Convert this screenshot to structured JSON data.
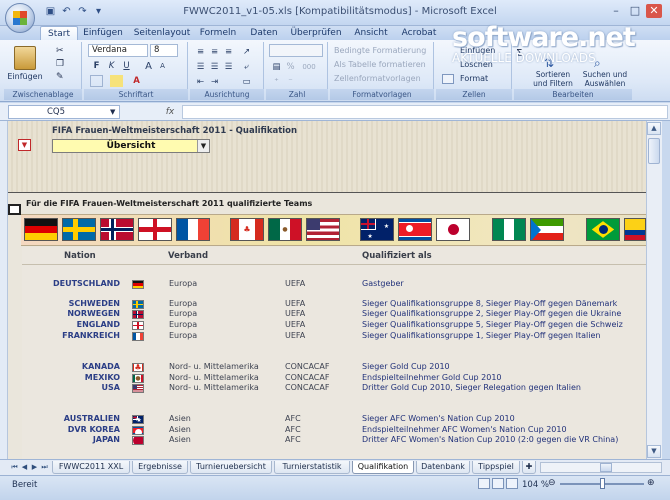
{
  "window": {
    "title": "FWWC2011_v1-05.xls  [Kompatibilitätsmodus] - Microsoft Excel",
    "minimize": "–",
    "maximize": "□",
    "close": "✕",
    "qat_icons": [
      "save-icon",
      "undo-icon",
      "redo-icon",
      "customize-icon"
    ],
    "qat_glyphs": [
      "▣",
      "↶",
      "↷",
      "▾"
    ]
  },
  "watermark": {
    "main": "software.net",
    "sub": "AKTUELLE DOWNLOADS"
  },
  "ribbon": {
    "tabs": [
      "Start",
      "Einfügen",
      "Seitenlayout",
      "Formeln",
      "Daten",
      "Überprüfen",
      "Ansicht",
      "Acrobat"
    ],
    "active_tab": "Start",
    "groups": {
      "clipboard": {
        "label": "Zwischenablage",
        "paste": "Einfügen"
      },
      "font": {
        "label": "Schriftart",
        "font_name": "Verdana",
        "font_size": "8",
        "bold": "F",
        "italic": "K",
        "underline": "U",
        "grow": "A",
        "shrink": "A"
      },
      "alignment": {
        "label": "Ausrichtung"
      },
      "number": {
        "label": "Zahl",
        "percent": "%",
        "thousands": "000"
      },
      "styles": {
        "label": "Formatvorlagen",
        "conditional": "Bedingte Formatierung",
        "as_table": "Als Tabelle formatieren",
        "cell_styles": "Zellenformatvorlagen"
      },
      "cells": {
        "label": "Zellen",
        "insert": "Einfügen",
        "delete": "Löschen",
        "format": "Format"
      },
      "editing": {
        "label": "Bearbeiten",
        "sort": "Sortieren und Filtern",
        "find": "Suchen und Auswählen"
      }
    }
  },
  "formula_bar": {
    "name_box": "CQ5",
    "fx": "fx",
    "content": ""
  },
  "sheet": {
    "title": "FIFA Frauen-Weltmeisterschaft 2011 - Qualifikation",
    "nav_dropdown": "Übersicht",
    "subheading": "Für die FIFA Frauen-Weltmeisterschaft 2011 qualifizierte Teams",
    "flags": [
      "germany",
      "sweden",
      "norway",
      "england",
      "france",
      "canada",
      "mexico",
      "usa",
      "australia",
      "dpr-korea",
      "japan",
      "nigeria",
      "equatorial-guinea",
      "brazil",
      "colombia"
    ],
    "headers": {
      "nation": "Nation",
      "verband": "Verband",
      "qualifiziert": "Qualifiziert als"
    },
    "rows": [
      {
        "nation": "DEUTSCHLAND",
        "flag": "germany",
        "region": "Europa",
        "conf": "UEFA",
        "qual": "Gastgeber"
      },
      {
        "nation": "SCHWEDEN",
        "flag": "sweden",
        "region": "Europa",
        "conf": "UEFA",
        "qual": "Sieger Qualifikationsgruppe 8, Sieger Play-Off gegen Dänemark"
      },
      {
        "nation": "NORWEGEN",
        "flag": "norway",
        "region": "Europa",
        "conf": "UEFA",
        "qual": "Sieger Qualifikationsgruppe 2, Sieger Play-Off gegen die Ukraine"
      },
      {
        "nation": "ENGLAND",
        "flag": "england",
        "region": "Europa",
        "conf": "UEFA",
        "qual": "Sieger Qualifikationsgruppe 5, Sieger Play-Off gegen die Schweiz"
      },
      {
        "nation": "FRANKREICH",
        "flag": "france",
        "region": "Europa",
        "conf": "UEFA",
        "qual": "Sieger Qualifikationsgruppe 1, Sieger Play-Off gegen Italien"
      },
      {
        "nation": "KANADA",
        "flag": "canada",
        "region": "Nord- u. Mittelamerika",
        "conf": "CONCACAF",
        "qual": "Sieger Gold Cup 2010"
      },
      {
        "nation": "MEXIKO",
        "flag": "mexico",
        "region": "Nord- u. Mittelamerika",
        "conf": "CONCACAF",
        "qual": "Endspielteilnehmer Gold Cup 2010"
      },
      {
        "nation": "USA",
        "flag": "usa",
        "region": "Nord- u. Mittelamerika",
        "conf": "CONCACAF",
        "qual": "Dritter Gold Cup 2010, Sieger Relegation gegen Italien"
      },
      {
        "nation": "AUSTRALIEN",
        "flag": "australia",
        "region": "Asien",
        "conf": "AFC",
        "qual": "Sieger AFC Women's Nation Cup 2010"
      },
      {
        "nation": "DVR KOREA",
        "flag": "dpr-korea",
        "region": "Asien",
        "conf": "AFC",
        "qual": "Endspielteilnehmer AFC Women's Nation Cup 2010"
      },
      {
        "nation": "JAPAN",
        "flag": "japan",
        "region": "Asien",
        "conf": "AFC",
        "qual": "Dritter AFC Women's Nation Cup 2010 (2:0 gegen die VR China)"
      }
    ]
  },
  "sheet_tabs": [
    "FWWC2011 XXL",
    "Ergebnisse",
    "Turnieruebersicht",
    "Turnierstatistik",
    "Qualifikation",
    "Datenbank",
    "Tippspiel"
  ],
  "active_sheet": "Qualifikation",
  "status": {
    "text": "Bereit",
    "zoom": "104 %"
  }
}
